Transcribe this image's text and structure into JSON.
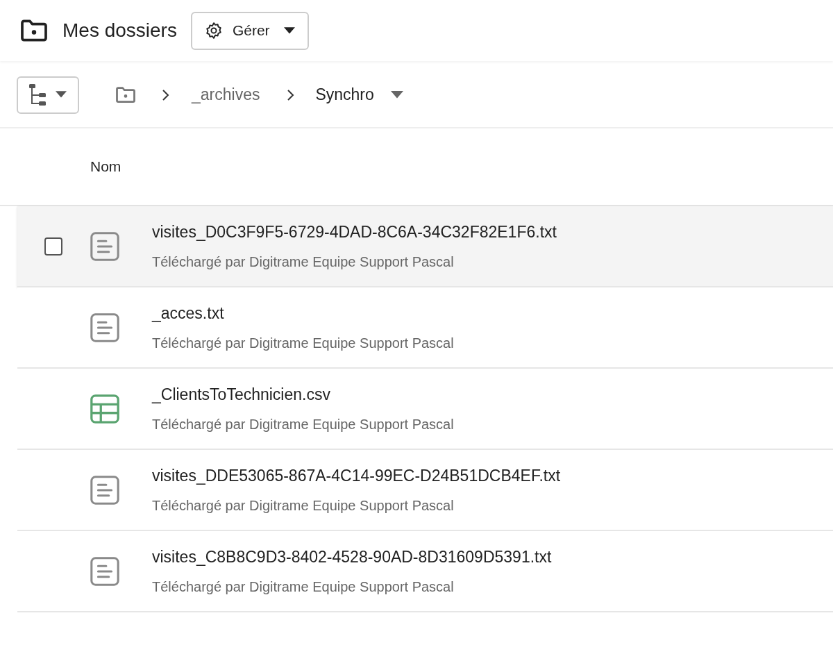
{
  "header": {
    "title": "Mes dossiers",
    "manage_button": "Gérer"
  },
  "breadcrumb": {
    "items": [
      "_archives"
    ],
    "current": "Synchro"
  },
  "table": {
    "columns": [
      "Nom"
    ],
    "rows": [
      {
        "kind": "text",
        "name": "visites_D0C3F9F5-6729-4DAD-8C6A-34C32F82E1F6.txt",
        "subtitle": "Téléchargé par Digitrame Equipe Support Pascal",
        "highlighted": true,
        "checked": false
      },
      {
        "kind": "text",
        "name": "_acces.txt",
        "subtitle": "Téléchargé par Digitrame Equipe Support Pascal",
        "highlighted": false,
        "checked": false
      },
      {
        "kind": "spreadsheet",
        "name": "_ClientsToTechnicien.csv",
        "subtitle": "Téléchargé par Digitrame Equipe Support Pascal",
        "highlighted": false,
        "checked": false
      },
      {
        "kind": "text",
        "name": "visites_DDE53065-867A-4C14-99EC-D24B51DCB4EF.txt",
        "subtitle": "Téléchargé par Digitrame Equipe Support Pascal",
        "highlighted": false,
        "checked": false
      },
      {
        "kind": "text",
        "name": "visites_C8B8C9D3-8402-4528-90AD-8D31609D5391.txt",
        "subtitle": "Téléchargé par Digitrame Equipe Support Pascal",
        "highlighted": false,
        "checked": false
      }
    ]
  }
}
